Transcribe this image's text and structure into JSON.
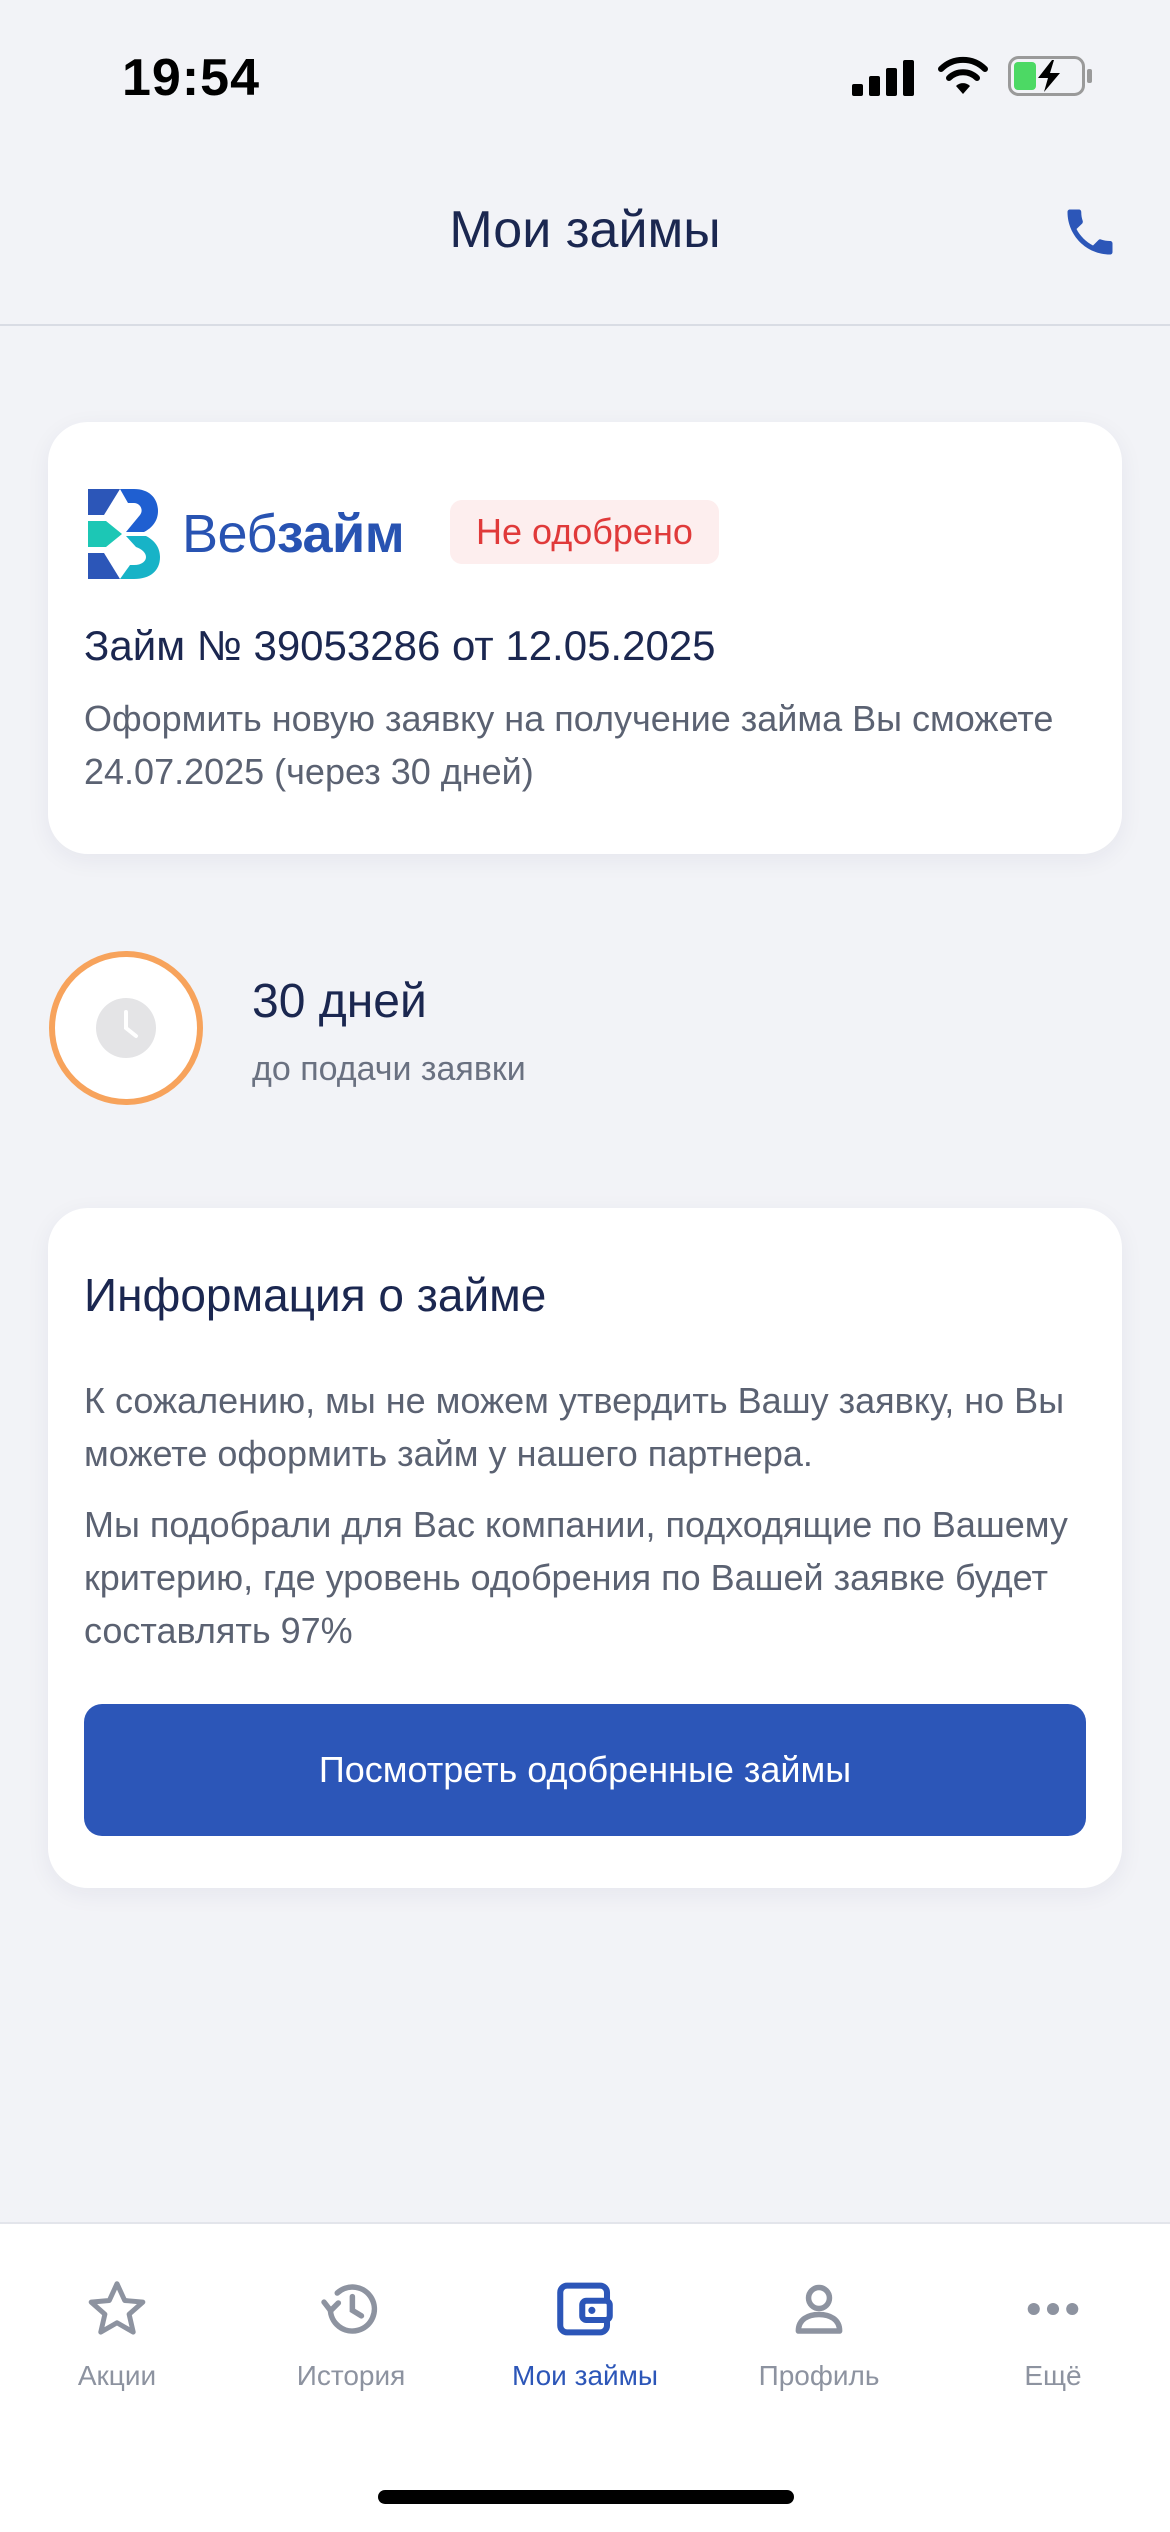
{
  "status_bar": {
    "time": "19:54"
  },
  "header": {
    "title": "Мои займы",
    "phone_icon": "phone-icon"
  },
  "loan_card": {
    "logo_text_light": "Веб",
    "logo_text_bold": "займ",
    "status": "Не одобрено",
    "title": "Займ № 39053286 от 12.05.2025",
    "description": "Оформить новую заявку на получение займа Вы сможете 24.07.2025 (через 30 дней)"
  },
  "timer": {
    "value": "30 дней",
    "label": "до подачи заявки"
  },
  "info_card": {
    "title": "Информация о займе",
    "paragraph1": "К сожалению, мы не можем утвердить Вашу заявку, но Вы можете оформить займ у нашего партнера.",
    "paragraph2": "Мы подобрали для Вас компании, подходящие по Вашему критерию, где уровень одобрения по Вашей заявке будет составлять 97%",
    "button_label": "Посмотреть одобренные займы"
  },
  "tabbar": {
    "items": [
      {
        "label": "Акции",
        "icon": "star-icon",
        "active": false
      },
      {
        "label": "История",
        "icon": "history-icon",
        "active": false
      },
      {
        "label": "Мои займы",
        "icon": "wallet-icon",
        "active": true
      },
      {
        "label": "Профиль",
        "icon": "profile-icon",
        "active": false
      },
      {
        "label": "Ещё",
        "icon": "more-icon",
        "active": false
      }
    ]
  },
  "colors": {
    "accent": "#2c56b8",
    "status_bg": "#fdeeee",
    "status_text": "#e03a3a",
    "timer_ring": "#f7a35c",
    "background": "#f2f3f7"
  }
}
